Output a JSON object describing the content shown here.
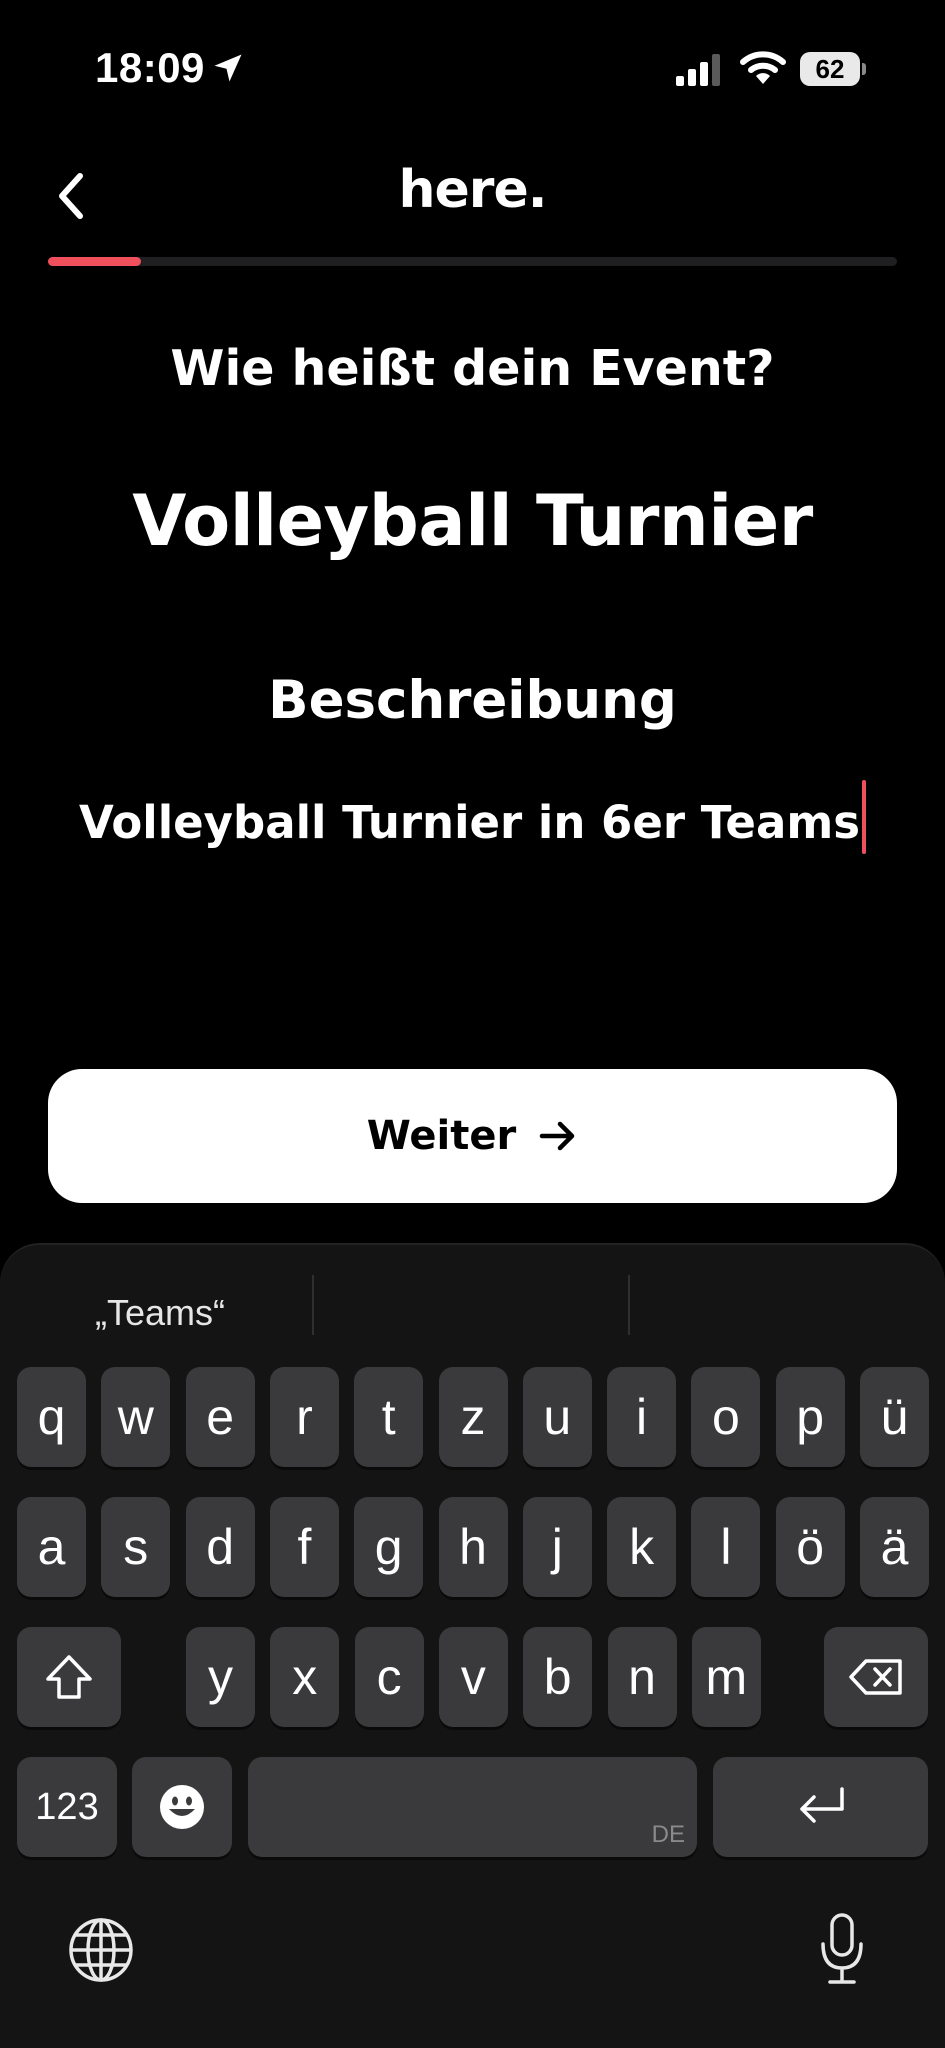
{
  "status_bar": {
    "time": "18:09",
    "battery": "62"
  },
  "header": {
    "logo": "here.",
    "progress_fraction": 0.11
  },
  "main": {
    "question": "Wie heißt dein Event?",
    "event_name": "Volleyball Turnier",
    "description_label": "Beschreibung",
    "description_value": "Volleyball Turnier in 6er Teams",
    "next_label": "Weiter"
  },
  "colors": {
    "accent": "#f0505c",
    "background": "#000000",
    "key": "#3a3a3c"
  },
  "keyboard": {
    "suggestions": [
      "„Teams“",
      "",
      ""
    ],
    "row1": [
      "q",
      "w",
      "e",
      "r",
      "t",
      "z",
      "u",
      "i",
      "o",
      "p",
      "ü"
    ],
    "row2": [
      "a",
      "s",
      "d",
      "f",
      "g",
      "h",
      "j",
      "k",
      "l",
      "ö",
      "ä"
    ],
    "row3": [
      "y",
      "x",
      "c",
      "v",
      "b",
      "n",
      "m"
    ],
    "numbers_label": "123",
    "language": "DE",
    "icons": [
      "shift-icon",
      "delete-icon",
      "emoji-icon",
      "return-icon",
      "globe-icon",
      "microphone-icon"
    ]
  }
}
